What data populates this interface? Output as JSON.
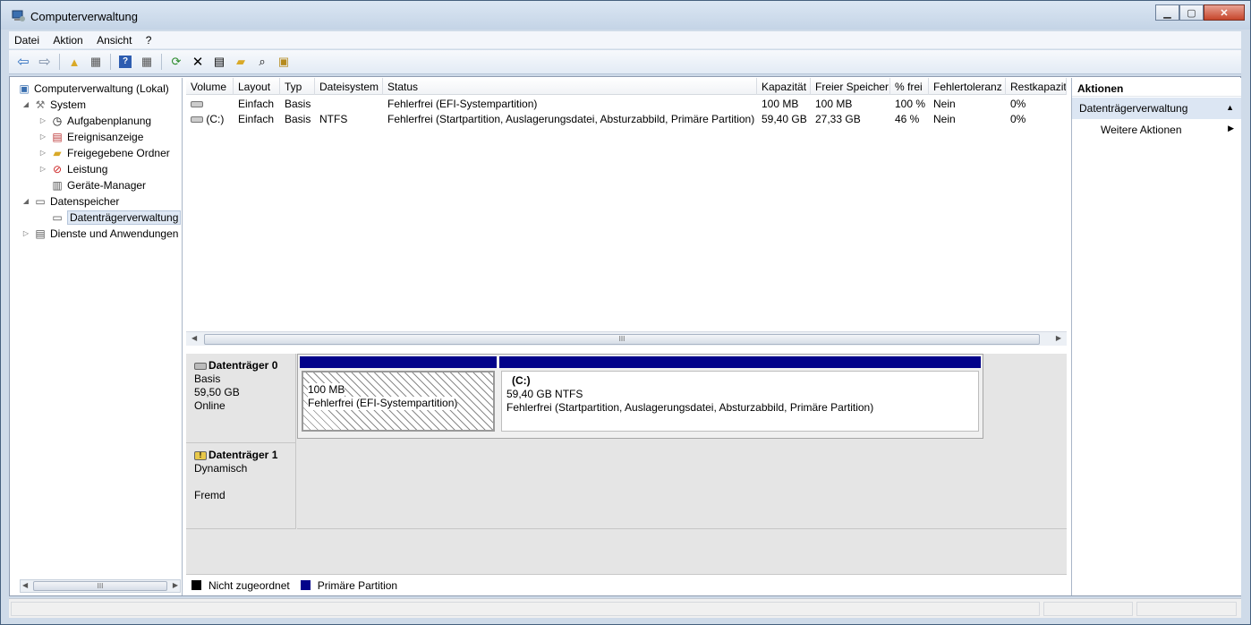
{
  "window": {
    "title": "Computerverwaltung"
  },
  "menu": [
    "Datei",
    "Aktion",
    "Ansicht",
    "?"
  ],
  "tree": {
    "root": "Computerverwaltung (Lokal)",
    "system": "System",
    "aufgaben": "Aufgabenplanung",
    "ereignis": "Ereignisanzeige",
    "freigabe": "Freigegebene Ordner",
    "leistung": "Leistung",
    "geraete": "Geräte-Manager",
    "datenspeicher": "Datenspeicher",
    "datentraeger": "Datenträgerverwaltung",
    "dienste": "Dienste und Anwendungen"
  },
  "columns": [
    "Volume",
    "Layout",
    "Typ",
    "Dateisystem",
    "Status",
    "Kapazität",
    "Freier Speicher",
    "% frei",
    "Fehlertoleranz",
    "Restkapazitä"
  ],
  "rows": [
    {
      "volume": "",
      "layout": "Einfach",
      "typ": "Basis",
      "fs": "",
      "status": "Fehlerfrei (EFI-Systempartition)",
      "kap": "100 MB",
      "frei": "100 MB",
      "pct": "100 %",
      "ft": "Nein",
      "rest": "0%"
    },
    {
      "volume": "(C:)",
      "layout": "Einfach",
      "typ": "Basis",
      "fs": "NTFS",
      "status": "Fehlerfrei (Startpartition, Auslagerungsdatei, Absturzabbild, Primäre Partition)",
      "kap": "59,40 GB",
      "frei": "27,33 GB",
      "pct": "46 %",
      "ft": "Nein",
      "rest": "0%"
    }
  ],
  "disk0": {
    "name": "Datenträger 0",
    "type": "Basis",
    "size": "59,50 GB",
    "state": "Online",
    "p1_size": "100 MB",
    "p1_status": "Fehlerfrei (EFI-Systempartition)",
    "p2_name": "(C:)",
    "p2_size": "59,40 GB NTFS",
    "p2_status": "Fehlerfrei (Startpartition, Auslagerungsdatei, Absturzabbild, Primäre Partition)"
  },
  "disk1": {
    "name": "Datenträger 1",
    "type": "Dynamisch",
    "state": "Fremd"
  },
  "legend": {
    "unalloc": "Nicht zugeordnet",
    "primary": "Primäre Partition"
  },
  "actions": {
    "header": "Aktionen",
    "section": "Datenträgerverwaltung",
    "more": "Weitere Aktionen"
  },
  "colors": {
    "primary": "#02028a",
    "unalloc": "#000000"
  },
  "scroll_glyph": "III"
}
